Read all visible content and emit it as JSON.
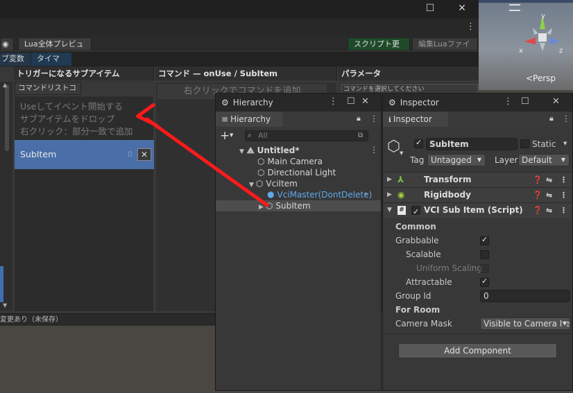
{
  "vci_window": {
    "tabs": [
      "Lua全体プレビュー"
    ],
    "toolbar": {
      "script_update": "スクリプト更新",
      "edit_lua": "編集Luaファイル"
    },
    "tabs2": [
      "ブ変数",
      "タイマー"
    ],
    "col1_header": "トリガーになるサブアイテム",
    "col2_header": "コマンド — onUse / SubItem",
    "col3_header": "パラメータ",
    "copy_button": "コマンドリストコピー",
    "hint_lines": [
      "Useしてイベント開始する",
      "サブアイテムをドロップ",
      "右クリック：部分一致で追加"
    ],
    "subitem_label": "SubItem",
    "subitem_count": "0",
    "command_hint": "右クリックでコマンドを追加",
    "param_hint": "コマンドを選択してください",
    "status_text": "変更あり（未保存）"
  },
  "scene": {
    "persp_label": "<Persp",
    "axis_y": "y",
    "axis_x": "x",
    "axis_z": "z"
  },
  "hierarchy": {
    "title": "Hierarchy",
    "tab": "Hierarchy",
    "search_placeholder": "All",
    "scene_name": "Untitled*",
    "items": [
      "Main Camera",
      "Directional Light",
      "VciItem",
      "VciMaster(DontDelete)",
      "SubItem"
    ]
  },
  "inspector": {
    "title": "Inspector",
    "tab": "Inspector",
    "object_name": "SubItem",
    "static_label": "Static",
    "tag_label": "Tag",
    "tag_value": "Untagged",
    "layer_label": "Layer",
    "layer_value": "Default",
    "components": [
      "Transform",
      "Rigidbody",
      "VCI Sub Item (Script)"
    ],
    "common_label": "Common",
    "grabbable_label": "Grabbable",
    "scalable_label": "Scalable",
    "uniform_label": "Uniform Scaling",
    "attractable_label": "Attractable",
    "group_label": "Group Id",
    "group_value": "0",
    "for_room_label": "For Room",
    "camera_mask_label": "Camera Mask",
    "camera_mask_value": "Visible to Camera Ite",
    "add_component": "Add Component"
  },
  "colors": {
    "accent_blue": "#4a6fa8",
    "arrow_red": "#ff1a1a"
  }
}
